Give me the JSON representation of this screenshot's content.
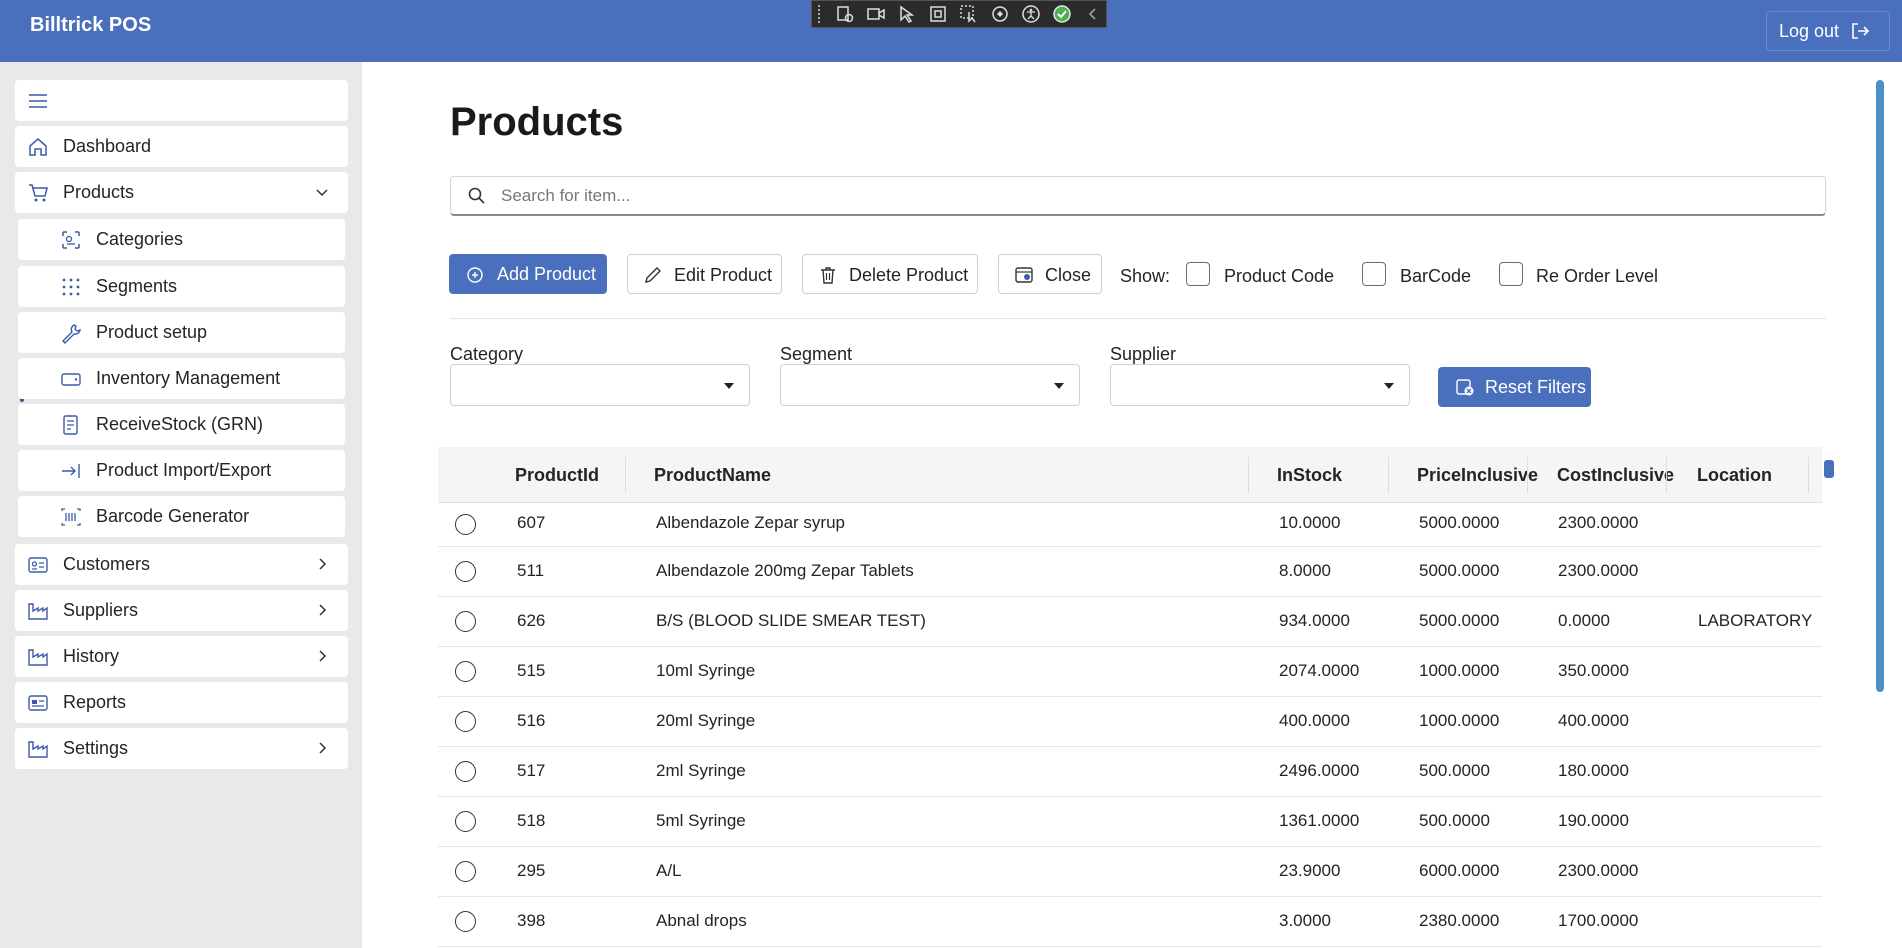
{
  "app": {
    "title": "Billtrick POS",
    "logout_label": "Log out"
  },
  "sidebar": {
    "items": [
      {
        "label": "Dashboard"
      },
      {
        "label": "Products"
      },
      {
        "label": "Categories"
      },
      {
        "label": "Segments"
      },
      {
        "label": "Product setup"
      },
      {
        "label": "Inventory Management"
      },
      {
        "label": "ReceiveStock (GRN)"
      },
      {
        "label": "Product Import/Export"
      },
      {
        "label": "Barcode Generator"
      },
      {
        "label": "Customers"
      },
      {
        "label": "Suppliers"
      },
      {
        "label": "History"
      },
      {
        "label": "Reports"
      },
      {
        "label": "Settings"
      }
    ]
  },
  "page": {
    "title": "Products",
    "search_placeholder": "Search for item..."
  },
  "toolbar": {
    "add": "Add Product",
    "edit": "Edit Product",
    "delete": "Delete Product",
    "close": "Close",
    "show_label": "Show:",
    "show_options": [
      "Product Code",
      "BarCode",
      "Re Order Level"
    ]
  },
  "filters": {
    "category_label": "Category",
    "segment_label": "Segment",
    "supplier_label": "Supplier",
    "reset_label": "Reset Filters"
  },
  "table": {
    "columns": [
      "ProductId",
      "ProductName",
      "InStock",
      "PriceInclusive",
      "CostInclusive",
      "Location"
    ],
    "rows": [
      [
        "607",
        "Albendazole Zepar syrup",
        "10.0000",
        "5000.0000",
        "2300.0000",
        ""
      ],
      [
        "511",
        "Albendazole 200mg Zepar Tablets",
        "8.0000",
        "5000.0000",
        "2300.0000",
        ""
      ],
      [
        "626",
        "B/S (BLOOD SLIDE SMEAR TEST)",
        "934.0000",
        "5000.0000",
        "0.0000",
        "LABORATORY"
      ],
      [
        "515",
        "10ml Syringe",
        "2074.0000",
        "1000.0000",
        "350.0000",
        ""
      ],
      [
        "516",
        "20ml Syringe",
        "400.0000",
        "1000.0000",
        "400.0000",
        ""
      ],
      [
        "517",
        "2ml Syringe",
        "2496.0000",
        "500.0000",
        "180.0000",
        ""
      ],
      [
        "518",
        "5ml Syringe",
        "1361.0000",
        "500.0000",
        "190.0000",
        ""
      ],
      [
        "295",
        "A/L",
        "23.9000",
        "6000.0000",
        "2300.0000",
        ""
      ],
      [
        "398",
        "Abnal drops",
        "3.0000",
        "2380.0000",
        "1700.0000",
        ""
      ]
    ]
  },
  "colors": {
    "accent": "#4a6fbc",
    "sidebar_bg": "#e9e9e9"
  }
}
